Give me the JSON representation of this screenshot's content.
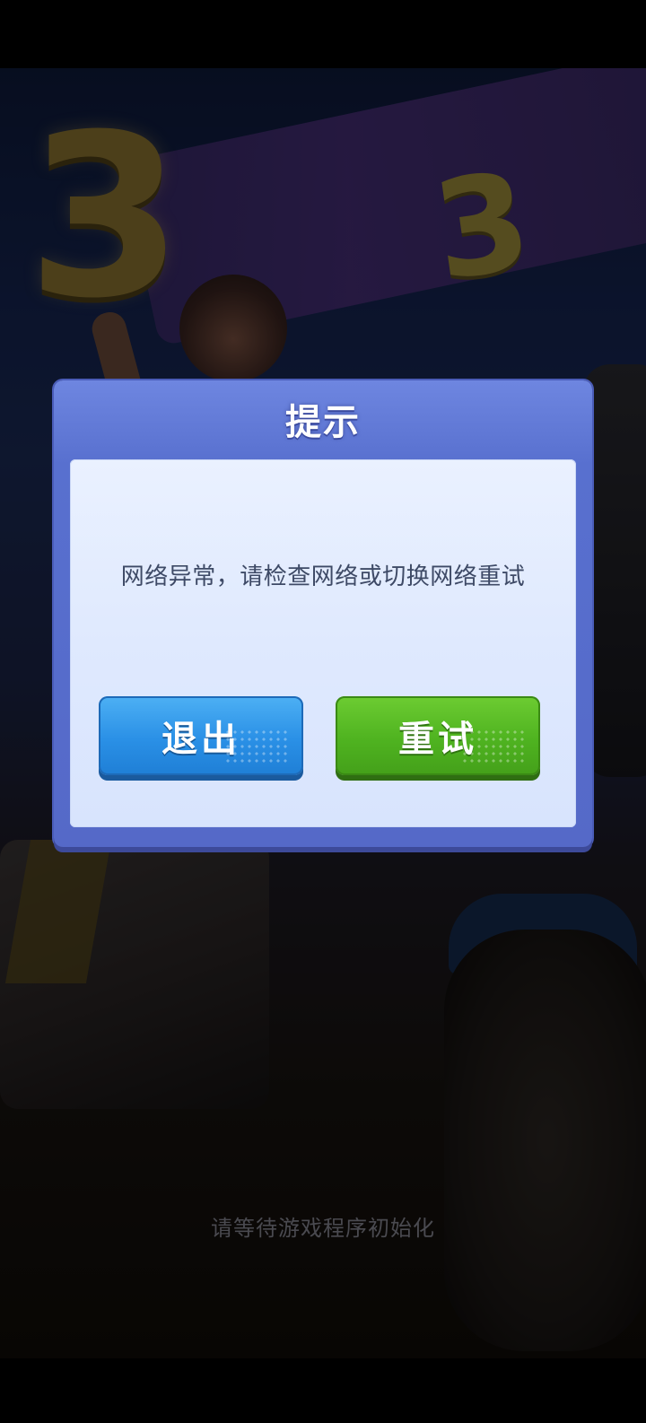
{
  "dialog": {
    "title": "提示",
    "message": "网络异常，请检查网络或切换网络重试",
    "exit_label": "退出",
    "retry_label": "重试"
  },
  "loading": {
    "status_text": "请等待游戏程序初始化"
  },
  "background": {
    "balloon_number": "3",
    "banner_number": "3"
  },
  "colors": {
    "dialog_frame": "#5870cf",
    "dialog_panel": "#dfe9fe",
    "exit_button": "#2a90e6",
    "retry_button": "#4fb320"
  }
}
